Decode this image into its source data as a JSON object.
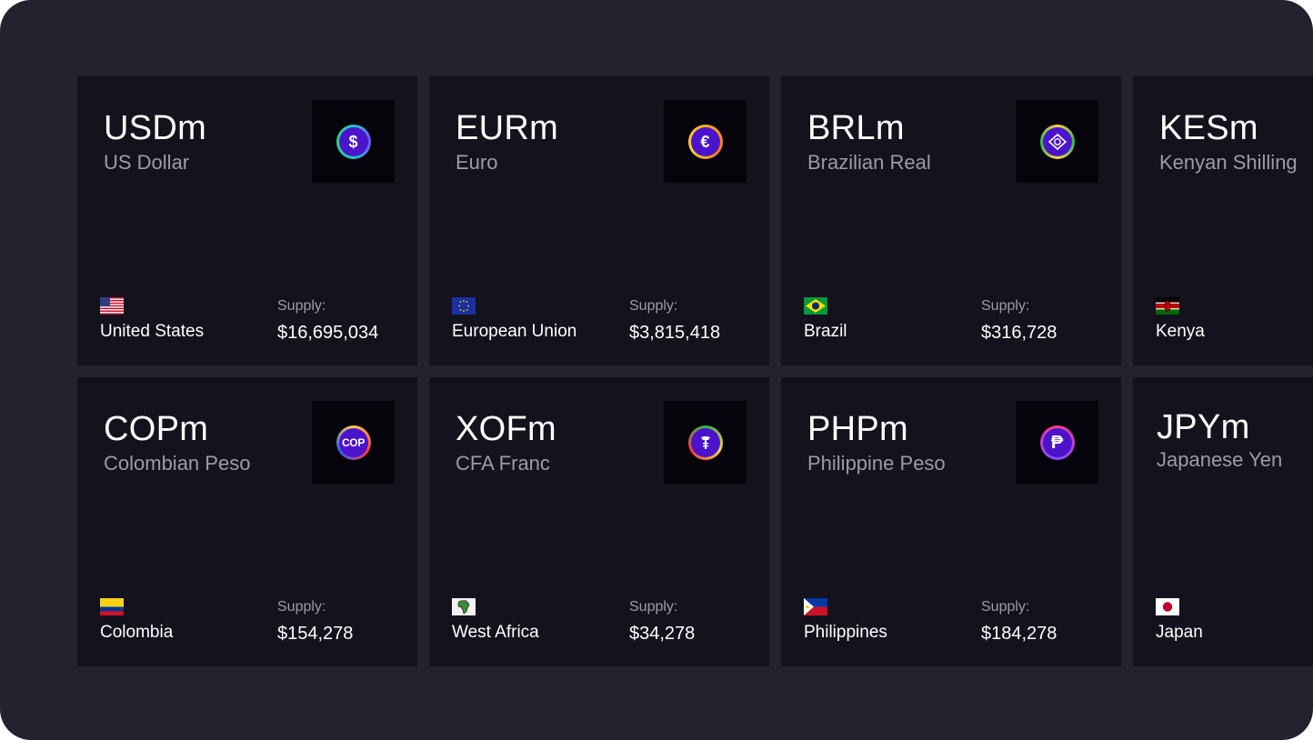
{
  "colors": {
    "background": "#25212f",
    "card": "#14121c",
    "icon_tile": "#06040b",
    "coin_fill": "#4b14cc",
    "text_primary": "#ffffff",
    "text_secondary": "#9e9ba8"
  },
  "cards": [
    {
      "code": "USDm",
      "name": "US Dollar",
      "country": "United States",
      "supply_label": "Supply:",
      "supply": "$16,695,034",
      "icon": "dollar-coin-icon",
      "flag": "us-flag-icon"
    },
    {
      "code": "EURm",
      "name": "Euro",
      "country": "European Union",
      "supply_label": "Supply:",
      "supply": "$3,815,418",
      "icon": "euro-coin-icon",
      "flag": "eu-flag-icon"
    },
    {
      "code": "BRLm",
      "name": "Brazilian Real",
      "country": "Brazil",
      "supply_label": "Supply:",
      "supply": "$316,728",
      "icon": "real-coin-icon",
      "flag": "brazil-flag-icon"
    },
    {
      "code": "KESm",
      "name": "Kenyan Shilling",
      "country": "Kenya",
      "icon": "shilling-coin-icon",
      "flag": "kenya-flag-icon"
    },
    {
      "code": "COPm",
      "name": "Colombian Peso",
      "country": "Colombia",
      "supply_label": "Supply:",
      "supply": "$154,278",
      "icon": "cop-coin-icon",
      "icon_text": "COP",
      "flag": "colombia-flag-icon"
    },
    {
      "code": "XOFm",
      "name": "CFA Franc",
      "country": "West Africa",
      "supply_label": "Supply:",
      "supply": "$34,278",
      "icon": "cfa-coin-icon",
      "flag": "west-africa-flag-icon"
    },
    {
      "code": "PHPm",
      "name": "Philippine Peso",
      "country": "Philippines",
      "supply_label": "Supply:",
      "supply": "$184,278",
      "icon": "peso-coin-icon",
      "icon_text": "₱",
      "flag": "philippines-flag-icon"
    },
    {
      "code": "JPYm",
      "name": "Japanese Yen",
      "country": "Japan",
      "icon": "yen-coin-icon",
      "flag": "japan-flag-icon"
    }
  ]
}
